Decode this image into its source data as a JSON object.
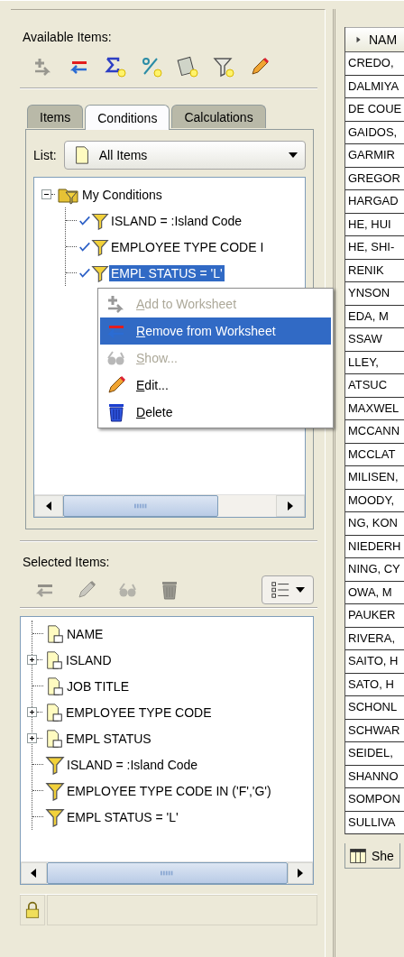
{
  "available_items": {
    "label": "Available Items:",
    "toolbar": [
      {
        "kind": "add",
        "disabled": true
      },
      {
        "kind": "remove",
        "disabled": false
      },
      {
        "kind": "sum",
        "disabled": false
      },
      {
        "kind": "percent",
        "disabled": false
      },
      {
        "kind": "calc",
        "disabled": false
      },
      {
        "kind": "condition",
        "disabled": false
      },
      {
        "kind": "edit",
        "disabled": false
      }
    ]
  },
  "tabs": [
    {
      "label": "Items",
      "selected": false
    },
    {
      "label": "Conditions",
      "selected": true
    },
    {
      "label": "Calculations",
      "selected": false
    }
  ],
  "list": {
    "label": "List:",
    "value": "All Items"
  },
  "conditions_tree": {
    "label": "My Conditions",
    "expanded": true,
    "children": [
      {
        "label": "ISLAND = :Island Code",
        "checked": true,
        "selected": false
      },
      {
        "label": "EMPLOYEE TYPE CODE I",
        "checked": true,
        "selected": false
      },
      {
        "label": "EMPL STATUS = 'L'",
        "checked": true,
        "selected": true
      }
    ]
  },
  "context_menu": [
    {
      "label": "Add to Worksheet",
      "kind": "add",
      "disabled": true,
      "selected": false
    },
    {
      "label": "Remove from Worksheet",
      "kind": "remove",
      "disabled": false,
      "selected": true
    },
    {
      "label": "Show...",
      "kind": "show",
      "disabled": true,
      "selected": false
    },
    {
      "label": "Edit...",
      "kind": "edit",
      "disabled": false,
      "selected": false
    },
    {
      "label": "Delete",
      "kind": "delete",
      "disabled": false,
      "selected": false
    }
  ],
  "selected_items": {
    "label": "Selected Items:",
    "toolbar": [
      {
        "kind": "remove",
        "disabled": true
      },
      {
        "kind": "edit",
        "disabled": true
      },
      {
        "kind": "show",
        "disabled": true
      },
      {
        "kind": "delete",
        "disabled": true
      }
    ],
    "tree": [
      {
        "label": "NAME",
        "kind": "item",
        "expandable": false
      },
      {
        "label": "ISLAND",
        "kind": "item",
        "expandable": true
      },
      {
        "label": "JOB TITLE",
        "kind": "item",
        "expandable": false
      },
      {
        "label": "EMPLOYEE TYPE CODE",
        "kind": "item",
        "expandable": true
      },
      {
        "label": "EMPL STATUS",
        "kind": "item",
        "expandable": true
      },
      {
        "label": "ISLAND = :Island Code",
        "kind": "condition",
        "expandable": false
      },
      {
        "label": "EMPLOYEE TYPE CODE IN ('F','G')",
        "kind": "condition",
        "expandable": false
      },
      {
        "label": "EMPL STATUS = 'L'",
        "kind": "condition",
        "expandable": false
      }
    ]
  },
  "worksheet": {
    "header": "NAM",
    "rows": [
      "CREDO,",
      "DALMIYA",
      "DE COUE",
      "GAIDOS,",
      "GARMIR",
      "GREGOR",
      "HARGAD",
      "HE, HUI",
      "HE, SHI-",
      "RENIK",
      "YNSON",
      "EDA, M",
      "SSAW",
      "LLEY,",
      "ATSUC",
      "MAXWEL",
      "MCCANN",
      "MCCLAT",
      "MILISEN,",
      "MOODY,",
      "NG, KON",
      "NIEDERH",
      "NING, CY",
      "OWA, M",
      "PAUKER",
      "RIVERA,",
      "SAITO, H",
      "SATO, H",
      "SCHONL",
      "SCHWAR",
      "SEIDEL,",
      "SHANNO",
      "SOMPON",
      "SULLIVA"
    ],
    "sheet_tab": "She"
  }
}
